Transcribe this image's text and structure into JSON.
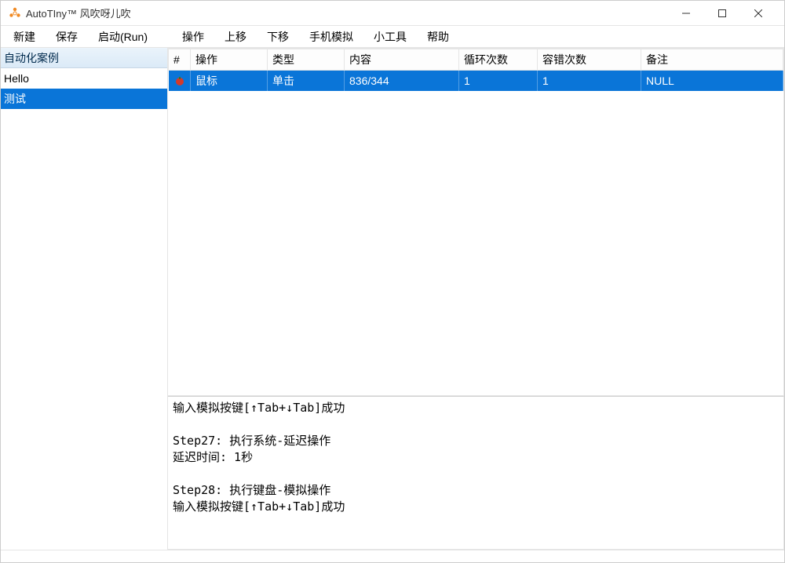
{
  "titlebar": {
    "app_name": "AutoTIny™ 风吹呀儿吹"
  },
  "menubar": {
    "group1": [
      "新建",
      "保存",
      "启动(Run)"
    ],
    "group2": [
      "操作",
      "上移",
      "下移",
      "手机模拟",
      "小工具",
      "帮助"
    ]
  },
  "sidebar": {
    "header": "自动化案例",
    "items": [
      {
        "label": "Hello",
        "selected": false
      },
      {
        "label": "测试",
        "selected": true
      }
    ]
  },
  "table": {
    "columns": [
      "#",
      "操作",
      "类型",
      "内容",
      "循环次数",
      "容错次数",
      "备注"
    ],
    "rows": [
      {
        "idx_icon": "red-dot",
        "op": "鼠标",
        "type": "单击",
        "content": "836/344",
        "loop": "1",
        "fault": "1",
        "note": "NULL",
        "selected": true
      }
    ]
  },
  "log": {
    "lines": [
      "输入模拟按键[↑Tab+↓Tab]成功",
      "",
      "Step27: 执行系统-延迟操作",
      "延迟时间: 1秒",
      "",
      "Step28: 执行键盘-模拟操作",
      "输入模拟按键[↑Tab+↓Tab]成功"
    ]
  }
}
